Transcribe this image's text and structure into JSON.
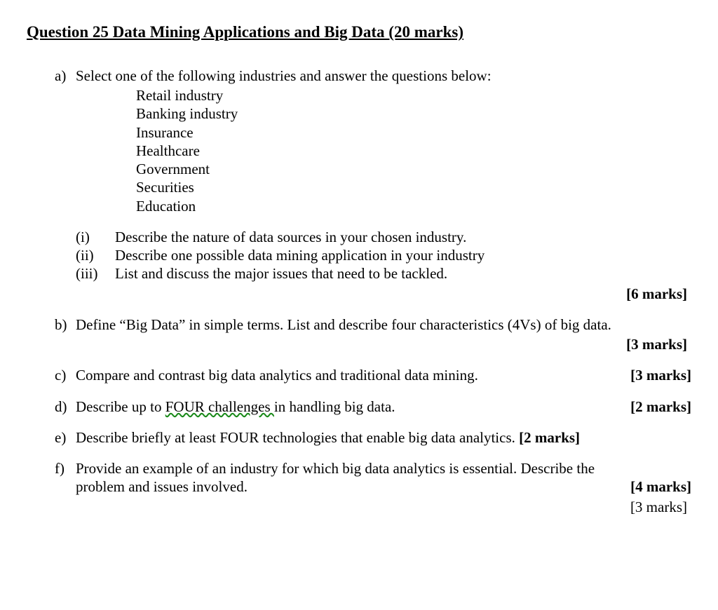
{
  "title": "Question 25 Data Mining Applications and Big Data (20 marks)",
  "a": {
    "label": "a)",
    "prompt": "Select one of the following industries and answer the questions below:",
    "industries": [
      "Retail industry",
      "Banking industry",
      "Insurance",
      "Healthcare",
      "Government",
      "Securities",
      "Education"
    ],
    "subs": {
      "i": {
        "label": "(i)",
        "text": "Describe the nature of data sources in your chosen industry."
      },
      "ii": {
        "label": "(ii)",
        "text": "Describe one possible data mining application in your industry"
      },
      "iii": {
        "label": "(iii)",
        "text": "List and discuss the major issues that need to be tackled."
      }
    },
    "marks": "[6 marks]"
  },
  "b": {
    "label": "b)",
    "text": "Define “Big Data” in simple terms. List and describe four characteristics (4Vs) of big data.",
    "marks": "[3 marks]"
  },
  "c": {
    "label": "c)",
    "text": "Compare and contrast big data analytics and traditional data mining.",
    "marks": "[3 marks]"
  },
  "d": {
    "label": "d)",
    "prefix": "Describe up to ",
    "wavy": "FOUR  challenges ",
    "suffix": "in handling big data.",
    "marks": "[2 marks]"
  },
  "e": {
    "label": "e)",
    "text": "Describe briefly at least FOUR technologies that enable big data analytics. ",
    "marks": "[2 marks]"
  },
  "f": {
    "label": "f)",
    "text": "Provide an example of an industry for which big data analytics is essential. Describe the problem and issues involved.",
    "marks": "[4 marks]",
    "marks2": "[3 marks]"
  }
}
